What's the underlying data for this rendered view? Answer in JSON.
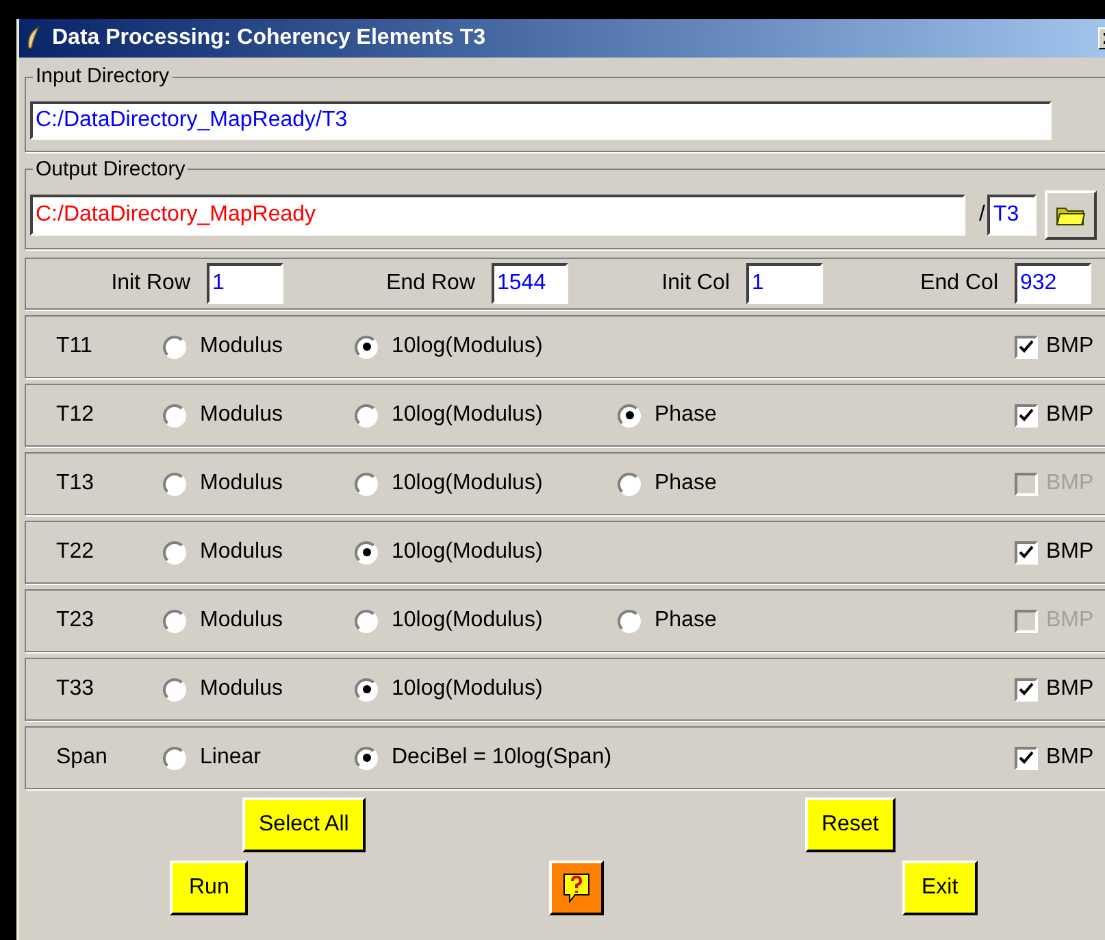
{
  "window": {
    "title": "Data Processing: Coherency Elements T3"
  },
  "input_directory": {
    "label": "Input Directory",
    "value": "C:/DataDirectory_MapReady/T3"
  },
  "output_directory": {
    "label": "Output Directory",
    "value": "C:/DataDirectory_MapReady",
    "separator": "/",
    "suffix": "T3"
  },
  "range": [
    {
      "label": "Init Row",
      "value": "1"
    },
    {
      "label": "End Row",
      "value": "1544"
    },
    {
      "label": "Init Col",
      "value": "1"
    },
    {
      "label": "End Col",
      "value": "932"
    }
  ],
  "elements": [
    {
      "label": "T11",
      "options": [
        {
          "label": "Modulus",
          "selected": false
        },
        {
          "label": "10log(Modulus)",
          "selected": true
        }
      ],
      "bmp": {
        "label": "BMP",
        "checked": true,
        "disabled": false
      }
    },
    {
      "label": "T12",
      "options": [
        {
          "label": "Modulus",
          "selected": false
        },
        {
          "label": "10log(Modulus)",
          "selected": false
        },
        {
          "label": "Phase",
          "selected": true
        }
      ],
      "bmp": {
        "label": "BMP",
        "checked": true,
        "disabled": false
      }
    },
    {
      "label": "T13",
      "options": [
        {
          "label": "Modulus",
          "selected": false
        },
        {
          "label": "10log(Modulus)",
          "selected": false
        },
        {
          "label": "Phase",
          "selected": false
        }
      ],
      "bmp": {
        "label": "BMP",
        "checked": false,
        "disabled": true
      }
    },
    {
      "label": "T22",
      "options": [
        {
          "label": "Modulus",
          "selected": false
        },
        {
          "label": "10log(Modulus)",
          "selected": true
        }
      ],
      "bmp": {
        "label": "BMP",
        "checked": true,
        "disabled": false
      }
    },
    {
      "label": "T23",
      "options": [
        {
          "label": "Modulus",
          "selected": false
        },
        {
          "label": "10log(Modulus)",
          "selected": false
        },
        {
          "label": "Phase",
          "selected": false
        }
      ],
      "bmp": {
        "label": "BMP",
        "checked": false,
        "disabled": true
      }
    },
    {
      "label": "T33",
      "options": [
        {
          "label": "Modulus",
          "selected": false
        },
        {
          "label": "10log(Modulus)",
          "selected": true
        }
      ],
      "bmp": {
        "label": "BMP",
        "checked": true,
        "disabled": false
      }
    },
    {
      "label": "Span",
      "options": [
        {
          "label": "Linear",
          "selected": false
        },
        {
          "label": "DeciBel = 10log(Span)",
          "selected": true
        }
      ],
      "bmp": {
        "label": "BMP",
        "checked": true,
        "disabled": false
      }
    }
  ],
  "buttons": {
    "select_all": "Select All",
    "reset": "Reset",
    "run": "Run",
    "exit": "Exit"
  }
}
